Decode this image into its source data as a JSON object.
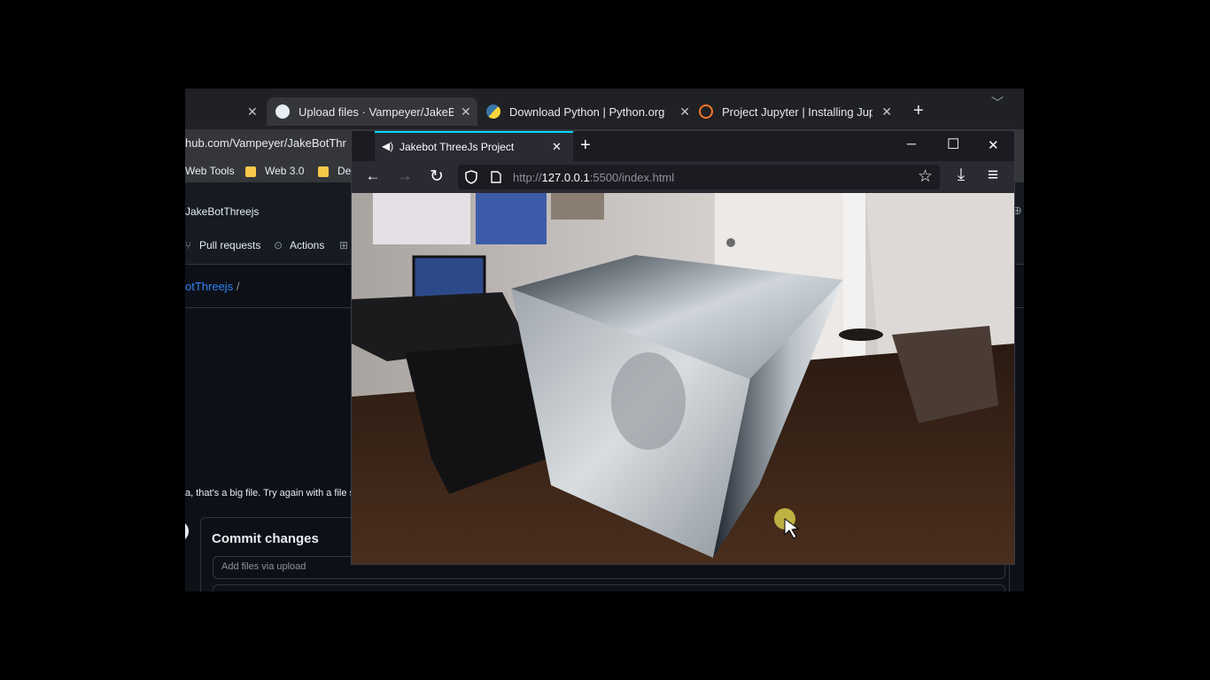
{
  "chrome": {
    "tabs": [
      {
        "label": "Upload files · Vampeyer/JakeBotT",
        "active": true
      },
      {
        "label": "Download Python | Python.org",
        "active": false
      },
      {
        "label": "Project Jupyter | Installing Jupyte",
        "active": false
      }
    ],
    "new_tab": "+",
    "close": "✕",
    "url": "hub.com/Vampeyer/JakeBotThr",
    "bookmarks": [
      "Web Tools",
      "Web 3.0",
      "De"
    ],
    "repo_name": "JakeBotThreejs",
    "nav_pull_requests": "Pull requests",
    "nav_actions": "Actions",
    "breadcrumb_repo": "otThreejs",
    "breadcrumb_sep": "/",
    "error_text": "a, that's a big file. Try again with a file s",
    "commit_title": "Commit changes",
    "commit_placeholder": "Add files via upload"
  },
  "firefox": {
    "tab_title": "Jakebot ThreeJs Project",
    "tab_close": "✕",
    "new_tab": "+",
    "url_prefix": "http://",
    "url_host": "127.0.0.1",
    "url_suffix": ":5500/index.html",
    "win_min": "─",
    "win_max": "☐",
    "win_close": "✕",
    "icons": {
      "back": "←",
      "forward": "→",
      "reload": "↻",
      "star": "☆",
      "download": "⤓",
      "menu": "≡",
      "speaker": "🔊"
    }
  },
  "scene": {
    "description_colors": {
      "wall": "#d9d6d3",
      "floor": "#3a2518",
      "cube": "#b8bec4"
    }
  }
}
